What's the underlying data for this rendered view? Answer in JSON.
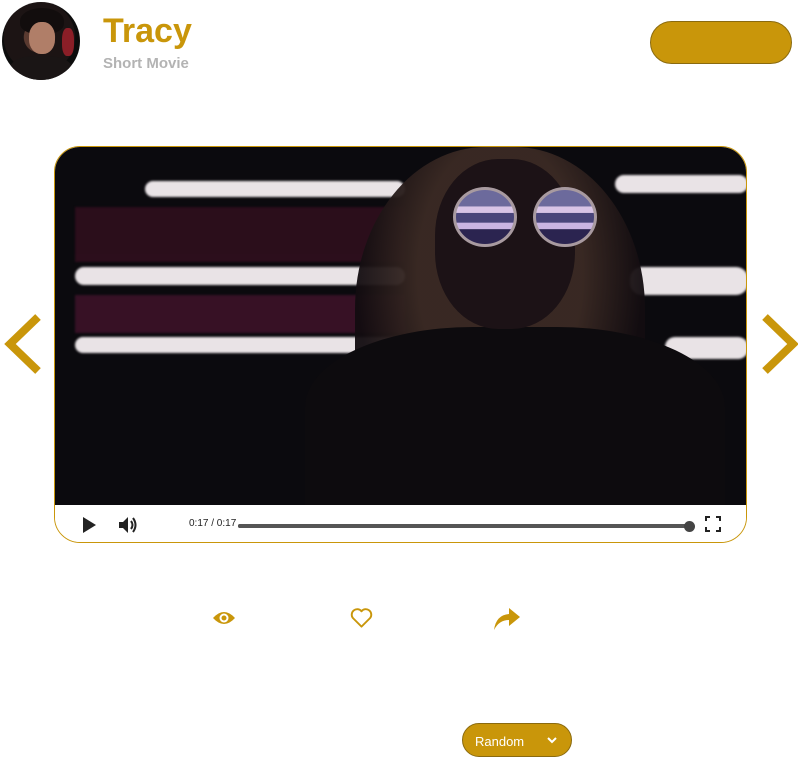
{
  "header": {
    "title": "Tracy",
    "subtitle": "Short Movie",
    "avatar_icon": "profile-photo"
  },
  "player": {
    "time_display": "0:17 / 0:17",
    "progress_fraction": 1.0,
    "icons": {
      "play": "play-icon",
      "volume": "volume-icon",
      "fullscreen": "fullscreen-icon"
    }
  },
  "navigation": {
    "prev_icon": "chevron-left-icon",
    "next_icon": "chevron-right-icon"
  },
  "actions": {
    "views_icon": "eye-icon",
    "like_icon": "heart-icon",
    "share_icon": "share-icon"
  },
  "sort": {
    "selected": "Random",
    "icon": "chevron-down-icon"
  },
  "colors": {
    "accent": "#c9960a",
    "subtitle": "#b3b3b3"
  }
}
